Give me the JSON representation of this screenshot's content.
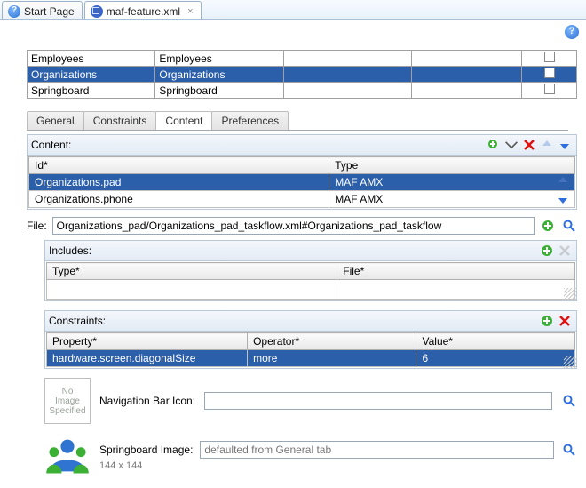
{
  "tabs": {
    "start": "Start Page",
    "file": "maf-feature.xml"
  },
  "features": {
    "rows": [
      {
        "id": "Employees",
        "name": "Employees"
      },
      {
        "id": "Organizations",
        "name": "Organizations"
      },
      {
        "id": "Springboard",
        "name": "Springboard"
      }
    ]
  },
  "subtabs": {
    "general": "General",
    "constraints": "Constraints",
    "content": "Content",
    "preferences": "Preferences"
  },
  "content": {
    "label": "Content:",
    "cols": {
      "id": "Id*",
      "type": "Type"
    },
    "rows": [
      {
        "id": "Organizations.pad",
        "type": "MAF AMX"
      },
      {
        "id": "Organizations.phone",
        "type": "MAF AMX"
      }
    ]
  },
  "file": {
    "label": "File:",
    "value": "Organizations_pad/Organizations_pad_taskflow.xml#Organizations_pad_taskflow"
  },
  "includes": {
    "label": "Includes:",
    "cols": {
      "type": "Type*",
      "file": "File*"
    }
  },
  "constraints": {
    "label": "Constraints:",
    "cols": {
      "property": "Property*",
      "operator": "Operator*",
      "value": "Value*"
    },
    "row": {
      "property": "hardware.screen.diagonalSize",
      "operator": "more",
      "value": "6"
    }
  },
  "navicon": {
    "noimg": "No\nImage\nSpecified",
    "label": "Navigation Bar Icon:",
    "value": ""
  },
  "springboard": {
    "label": "Springboard Image:",
    "placeholder": "defaulted from General tab",
    "dims": "144 x 144"
  },
  "icons": {
    "add": "add",
    "adddd": "add-dropdown",
    "del": "delete",
    "up": "up",
    "down": "down",
    "search": "search"
  }
}
